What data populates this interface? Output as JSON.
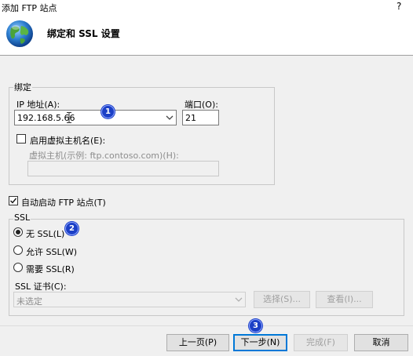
{
  "window": {
    "title": "添加 FTP 站点",
    "help_glyph": "?"
  },
  "header": {
    "title": "绑定和 SSL 设置"
  },
  "binding": {
    "group_label": "绑定",
    "ip_label": "IP 地址(A):",
    "ip_value": "192.168.5.66",
    "port_label": "端口(O):",
    "port_value": "21",
    "virtual_host_checkbox": "启用虚拟主机名(E):",
    "virtual_host_label": "虚拟主机(示例: ftp.contoso.com)(H):",
    "virtual_host_value": ""
  },
  "autostart": {
    "label": "自动启动 FTP 站点(T)",
    "checked": true
  },
  "ssl": {
    "group_label": "SSL",
    "options": [
      "无 SSL(L)",
      "允许 SSL(W)",
      "需要 SSL(R)"
    ],
    "selected_index": 0,
    "cert_label": "SSL 证书(C):",
    "cert_value": "未选定",
    "select_button": "选择(S)...",
    "view_button": "查看(I)..."
  },
  "footer": {
    "prev": "上一页(P)",
    "next": "下一步(N)",
    "finish": "完成(F)",
    "cancel": "取消"
  },
  "annotations": [
    "1",
    "2",
    "3"
  ],
  "colors": {
    "badge": "#1b3fc6",
    "default_button_border": "#0078d7",
    "disabled_text": "#8d8d8d"
  }
}
